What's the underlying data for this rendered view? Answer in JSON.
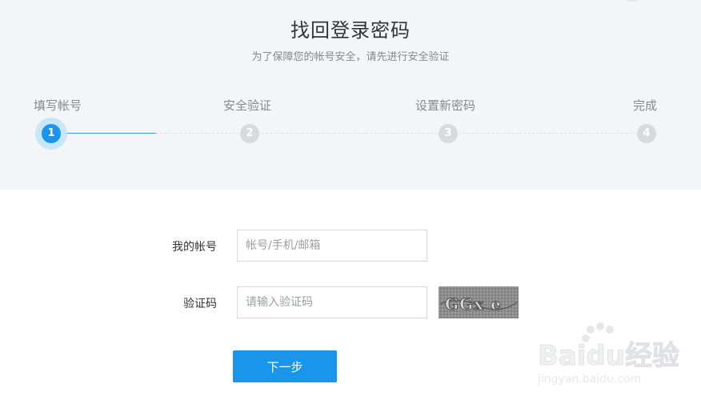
{
  "header": {
    "title": "找回登录密码",
    "subtitle": "为了保障您的帐号安全，请先进行安全验证"
  },
  "steps": [
    {
      "label": "填写帐号",
      "number": "1",
      "active": true
    },
    {
      "label": "安全验证",
      "number": "2",
      "active": false
    },
    {
      "label": "设置新密码",
      "number": "3",
      "active": false
    },
    {
      "label": "完成",
      "number": "4",
      "active": false
    }
  ],
  "form": {
    "account": {
      "label": "我的帐号",
      "placeholder": "帐号/手机/邮箱",
      "value": ""
    },
    "captcha": {
      "label": "验证码",
      "placeholder": "请输入验证码",
      "value": "",
      "image_text": "GGx e"
    },
    "next_button": "下一步"
  },
  "watermark": {
    "brand": "Baidu经验",
    "url": "jingyan.baidu.com"
  },
  "colors": {
    "accent": "#1a95ec",
    "header_bg": "#f4f5f8",
    "inactive_step": "#d8dadf"
  }
}
